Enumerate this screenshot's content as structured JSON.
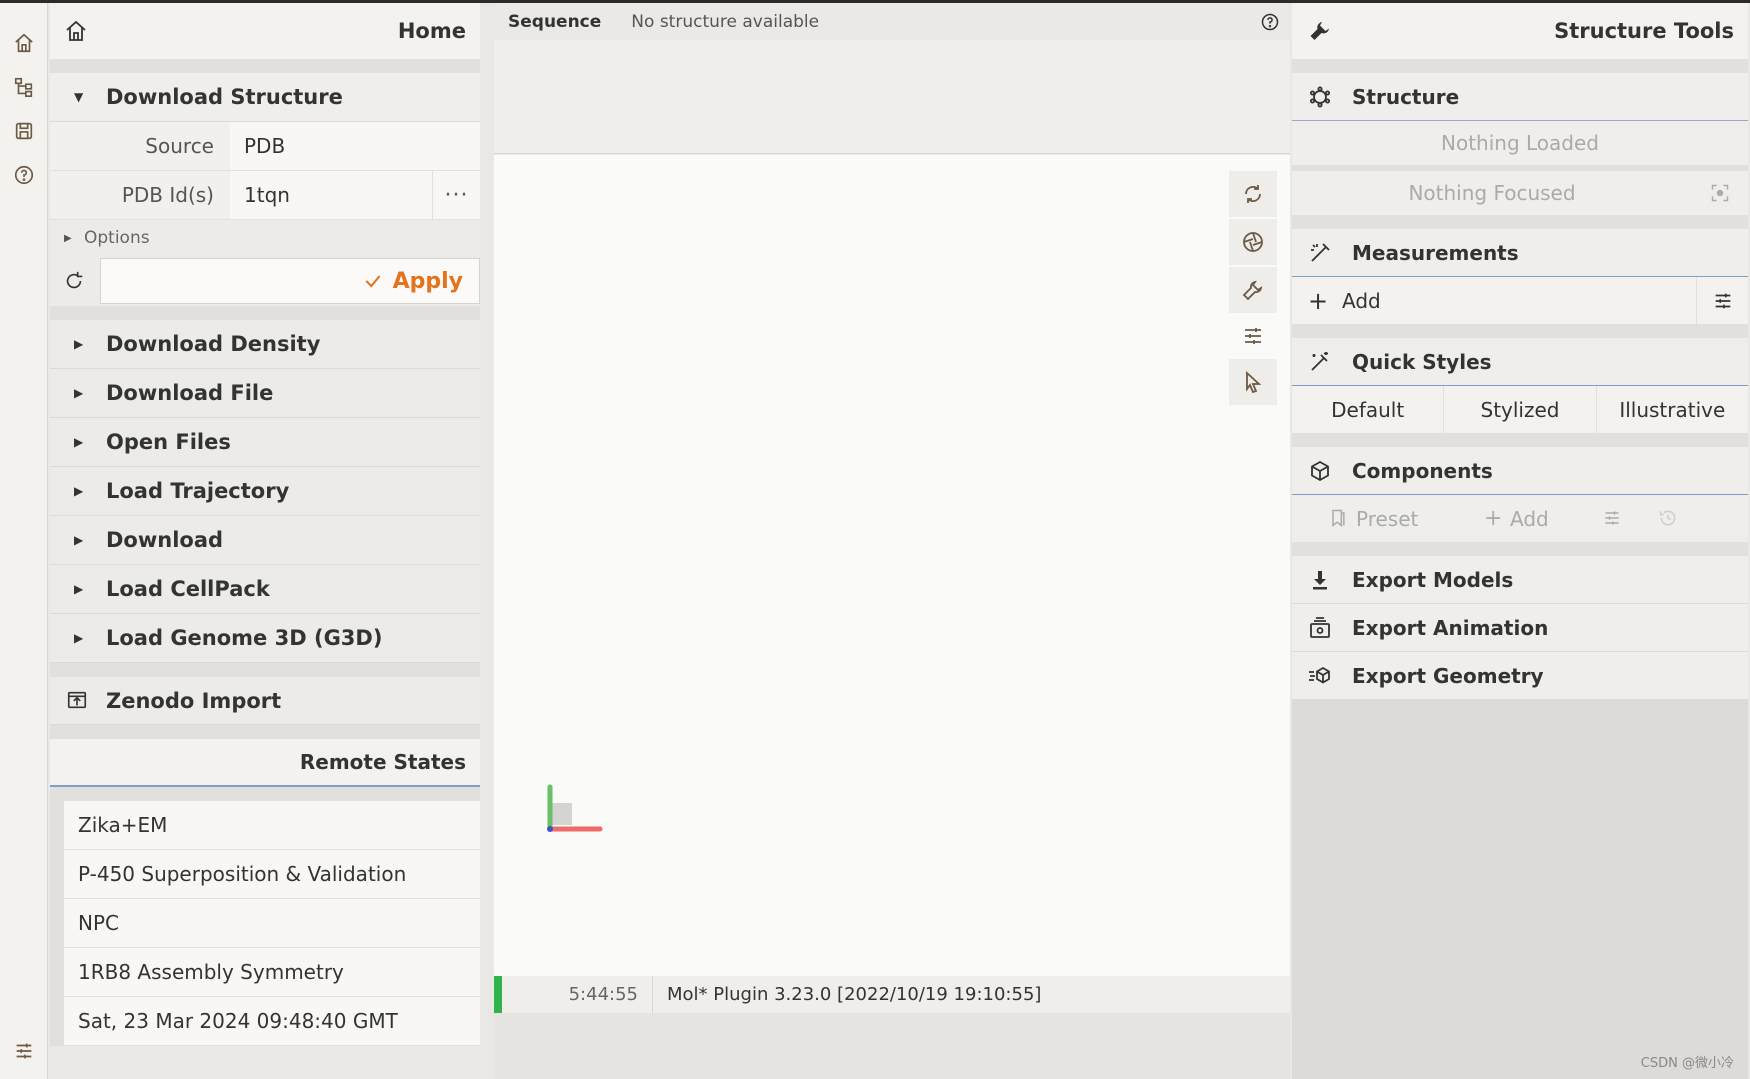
{
  "left": {
    "header_title": "Home",
    "download_structure": {
      "title": "Download Structure",
      "source_label": "Source",
      "source_value": "PDB",
      "pdb_label": "PDB Id(s)",
      "pdb_value": "1tqn",
      "more": "···",
      "options_label": "Options",
      "apply_label": "Apply"
    },
    "sections": [
      "Download Density",
      "Download File",
      "Open Files",
      "Load Trajectory",
      "Download",
      "Load CellPack",
      "Load Genome 3D (G3D)"
    ],
    "zenodo_label": "Zenodo Import",
    "remote_states_title": "Remote States",
    "remote_states": [
      "Zika+EM",
      "P-450 Superposition & Validation",
      "NPC",
      "1RB8 Assembly Symmetry",
      "Sat, 23 Mar 2024 09:48:40 GMT"
    ]
  },
  "center": {
    "sequence_label": "Sequence",
    "sequence_value": "No structure available",
    "log_time": "5:44:55",
    "log_message": "Mol* Plugin 3.23.0 [2022/10/19 19:10:55]"
  },
  "right": {
    "header_title": "Structure Tools",
    "structure_title": "Structure",
    "nothing_loaded": "Nothing Loaded",
    "nothing_focused": "Nothing Focused",
    "measurements_title": "Measurements",
    "measurements_add": "Add",
    "quick_styles_title": "Quick Styles",
    "quick_styles": [
      "Default",
      "Stylized",
      "Illustrative"
    ],
    "components_title": "Components",
    "components_preset": "Preset",
    "components_add": "Add",
    "export_models": "Export Models",
    "export_animation": "Export Animation",
    "export_geometry": "Export Geometry"
  },
  "watermark": "CSDN @微小冷",
  "colors": {
    "accent_apply": "#e4731b",
    "log_ok": "#2fb34a",
    "underline_blue": "#7aa0c9",
    "underline_purple": "#b199cf"
  }
}
